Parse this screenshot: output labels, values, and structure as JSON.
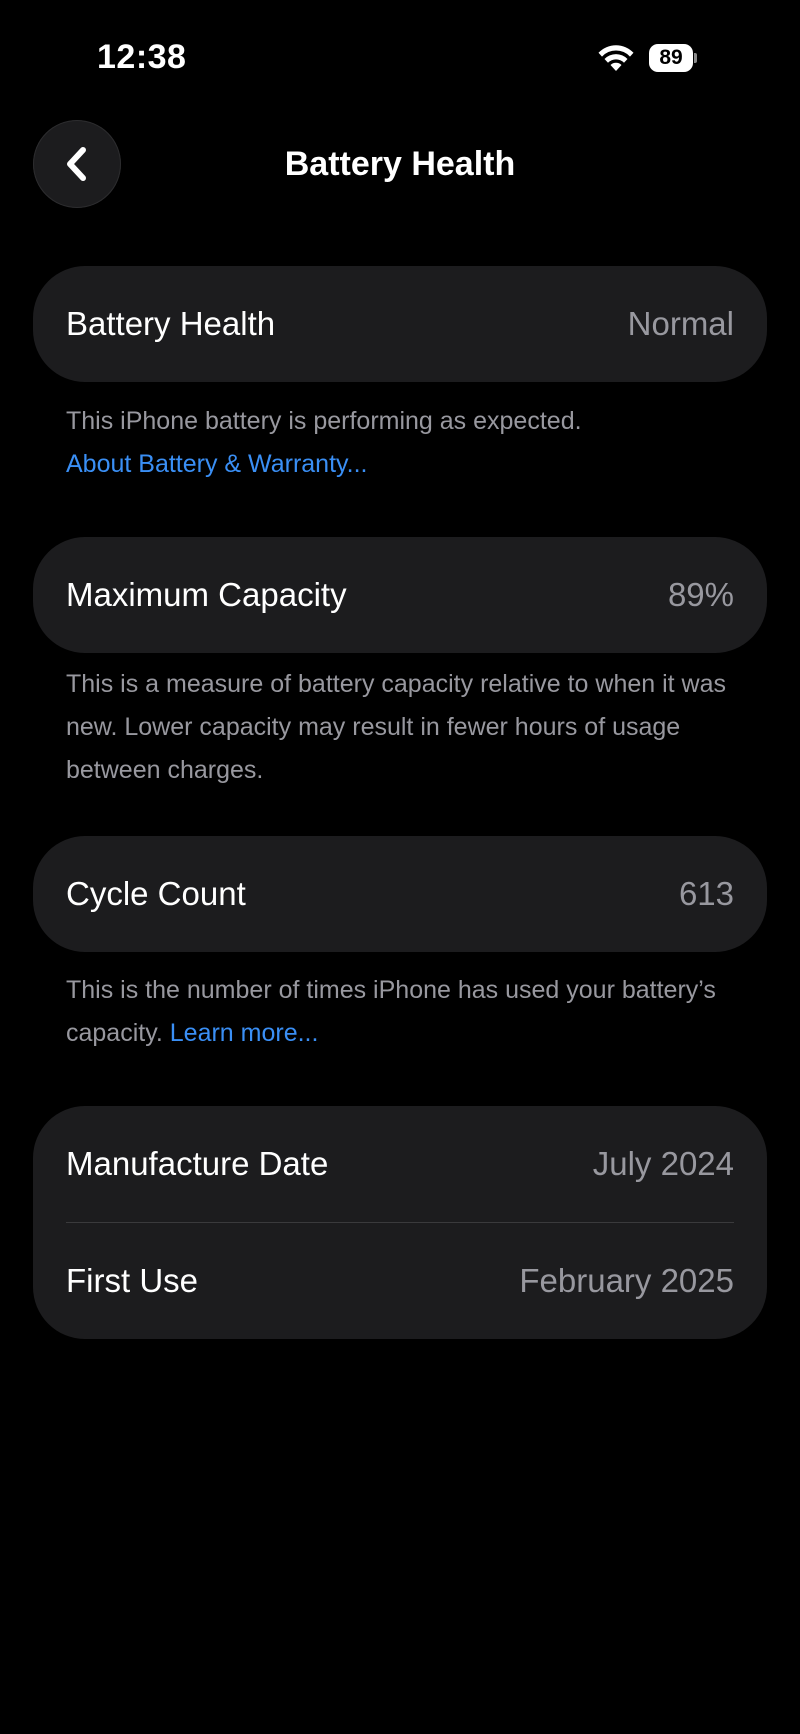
{
  "status_bar": {
    "time": "12:38",
    "battery_level": "89"
  },
  "nav": {
    "title": "Battery Health",
    "back_icon": "chevron-left-icon"
  },
  "battery_health": {
    "label": "Battery Health",
    "value": "Normal",
    "note": "This iPhone battery is performing as expected.",
    "link": "About Battery & Warranty..."
  },
  "maximum_capacity": {
    "label": "Maximum Capacity",
    "value": "89%",
    "note": "This is a measure of battery capacity relative to when it was new. Lower capacity may result in fewer hours of usage between charges."
  },
  "cycle_count": {
    "label": "Cycle Count",
    "value": "613",
    "note": "This is the number of times iPhone has used your battery’s capacity.",
    "link": "Learn more..."
  },
  "dates": {
    "manufacture_label": "Manufacture Date",
    "manufacture_value": "July 2024",
    "first_use_label": "First Use",
    "first_use_value": "February 2025"
  },
  "colors": {
    "background": "#000000",
    "card": "#1c1c1e",
    "secondary_text": "#98989f",
    "link": "#3a8ff5"
  }
}
